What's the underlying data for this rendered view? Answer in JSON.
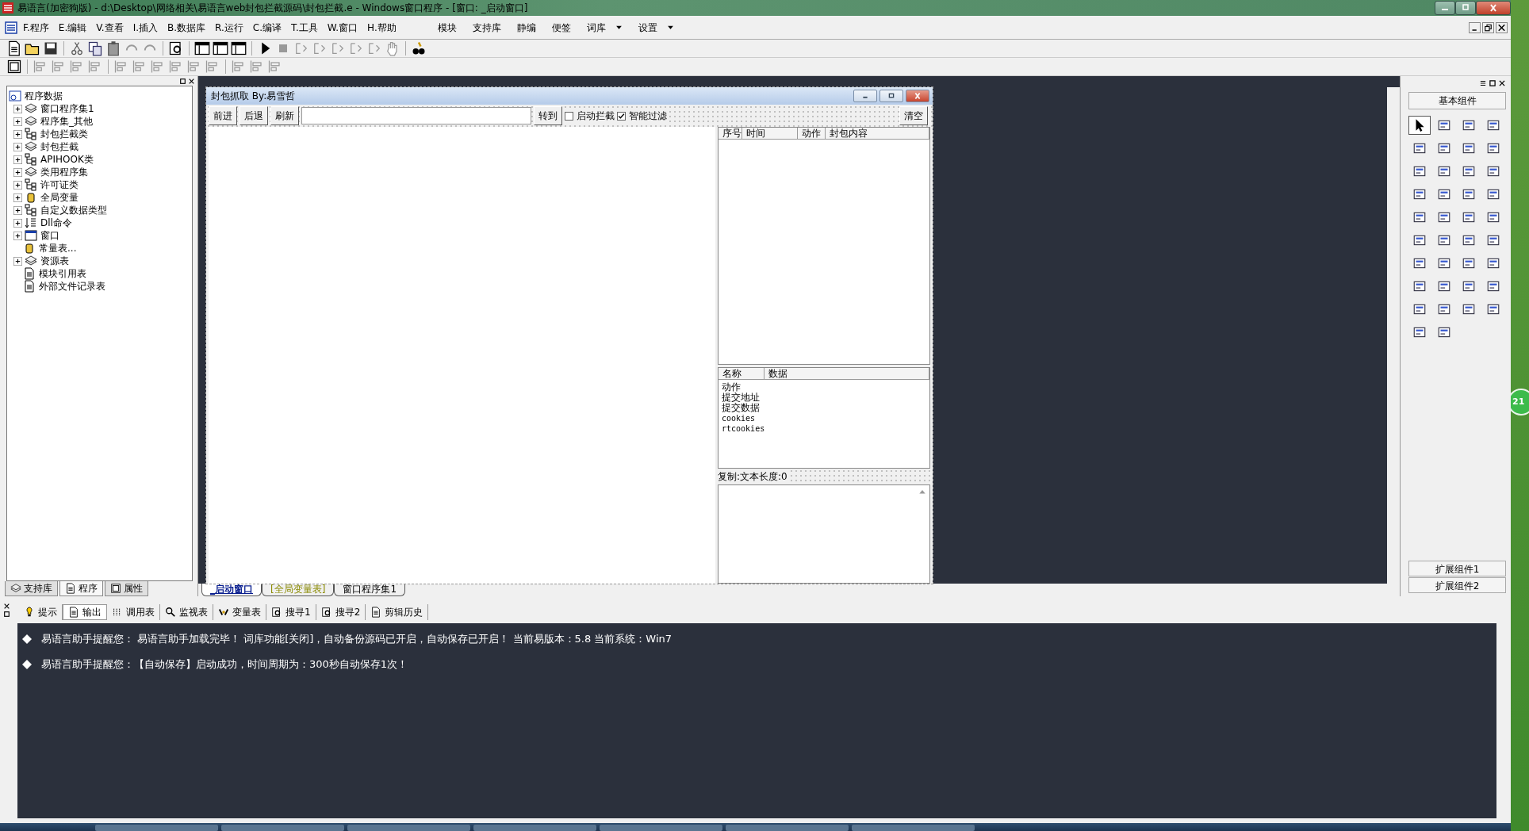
{
  "window": {
    "title": "易语言(加密狗版) - d:\\Desktop\\网络相关\\易语言web封包拦截源码\\封包拦截.e - Windows窗口程序 - [窗口: _启动窗口]"
  },
  "menu": {
    "items": [
      {
        "label": "F.程序"
      },
      {
        "label": "E.编辑"
      },
      {
        "label": "V.查看"
      },
      {
        "label": "I.插入"
      },
      {
        "label": "B.数据库"
      },
      {
        "label": "R.运行"
      },
      {
        "label": "C.编译"
      },
      {
        "label": "T.工具"
      },
      {
        "label": "W.窗口"
      },
      {
        "label": "H.帮助"
      }
    ],
    "right_items": [
      {
        "label": "模块",
        "kind": "plain"
      },
      {
        "label": "支持库",
        "kind": "plain"
      },
      {
        "label": "静编",
        "kind": "plain"
      },
      {
        "label": "便签",
        "kind": "plain"
      },
      {
        "label": "词库",
        "kind": "dropdown"
      },
      {
        "label": "设置",
        "kind": "dropdown"
      }
    ]
  },
  "tree": {
    "root": "程序数据",
    "children": [
      {
        "label": "窗口程序集1",
        "expandable": true,
        "kind": "books"
      },
      {
        "label": "程序集_其他",
        "expandable": true,
        "kind": "books"
      },
      {
        "label": "封包拦截类",
        "expandable": true,
        "kind": "class"
      },
      {
        "label": "封包拦截",
        "expandable": true,
        "kind": "books"
      },
      {
        "label": "APIHOOK类",
        "expandable": true,
        "kind": "class"
      },
      {
        "label": "类用程序集",
        "expandable": true,
        "kind": "books"
      },
      {
        "label": "许可证类",
        "expandable": true,
        "kind": "class"
      },
      {
        "label": "全局变量",
        "expandable": true,
        "kind": "jar"
      },
      {
        "label": "自定义数据类型",
        "expandable": true,
        "kind": "class"
      },
      {
        "label": "Dll命令",
        "expandable": true,
        "kind": "list"
      },
      {
        "label": "窗口",
        "expandable": true,
        "kind": "window"
      },
      {
        "label": "常量表...",
        "expandable": false,
        "kind": "jar"
      },
      {
        "label": "资源表",
        "expandable": true,
        "kind": "books"
      },
      {
        "label": "模块引用表",
        "expandable": false,
        "kind": "doc"
      },
      {
        "label": "外部文件记录表",
        "expandable": false,
        "kind": "doc"
      }
    ]
  },
  "left_tabs": [
    {
      "label": "支持库",
      "selected": false
    },
    {
      "label": "程序",
      "selected": true
    },
    {
      "label": "属性",
      "selected": false
    }
  ],
  "form": {
    "title": "封包抓取 By:易雪哲",
    "nav_buttons": [
      "前进",
      "后退",
      "刷新"
    ],
    "go_button": "转到",
    "checkboxes": [
      {
        "label": "启动拦截",
        "checked": false
      },
      {
        "label": "智能过滤",
        "checked": true
      }
    ],
    "clear_button": "清空",
    "packet_list": {
      "columns": [
        "序号",
        "时间",
        "动作",
        "封包内容"
      ]
    },
    "field_list": {
      "columns": [
        "名称",
        "数据"
      ],
      "rows": [
        "动作",
        "提交地址",
        "提交数据",
        "cookies",
        "rtcookies"
      ]
    },
    "copy_label": "复制:文本长度:0"
  },
  "editor_tabs": [
    {
      "label": "_启动窗口",
      "selected": true,
      "kind": "window"
    },
    {
      "label": "[全局变量表]",
      "selected": false,
      "kind": "global"
    },
    {
      "label": "窗口程序集1",
      "selected": false,
      "kind": "window"
    }
  ],
  "toolbox": {
    "title": "基本组件",
    "groups": [
      "扩展组件1",
      "扩展组件2"
    ]
  },
  "output_tabs": [
    {
      "label": "提示",
      "selected": false
    },
    {
      "label": "输出",
      "selected": true
    },
    {
      "label": "调用表",
      "selected": false
    },
    {
      "label": "监视表",
      "selected": false
    },
    {
      "label": "变量表",
      "selected": false
    },
    {
      "label": "搜寻1",
      "selected": false
    },
    {
      "label": "搜寻2",
      "selected": false
    },
    {
      "label": "剪辑历史",
      "selected": false
    }
  ],
  "messages": [
    "易语言助手提醒您：  易语言助手加载完毕！  词库功能[关闭]，自动备份源码已开启，自动保存已开启！  当前易版本：5.8  当前系统：Win7",
    "易语言助手提醒您：【自动保存】启动成功，时间周期为：300秒自动保存1次！"
  ],
  "desktop_badge": "21"
}
